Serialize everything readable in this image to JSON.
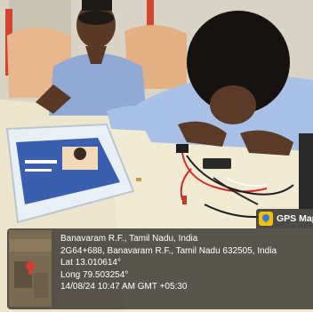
{
  "badge": {
    "app_name": "GPS Map"
  },
  "overlay": {
    "place": "Banavaram R.F., Tamil Nadu, India",
    "address": "2G64+688, Banavaram R.F., Tamil Nadu 632505, India",
    "latitude": "Lat 13.010614°",
    "longitude": "Long 79.503254°",
    "datetime": "14/08/24 10:47 AM GMT +05:30"
  }
}
